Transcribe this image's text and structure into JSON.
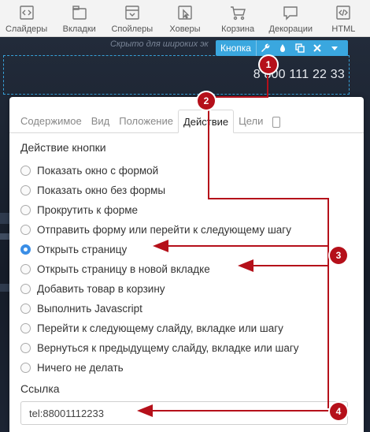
{
  "toolbar": {
    "items": [
      {
        "label": "Слайдеры",
        "icon": "sliders-icon"
      },
      {
        "label": "Вкладки",
        "icon": "tabs-icon"
      },
      {
        "label": "Спойлеры",
        "icon": "spoilers-icon"
      },
      {
        "label": "Ховеры",
        "icon": "hovers-icon"
      },
      {
        "label": "Корзина",
        "icon": "cart-icon"
      },
      {
        "label": "Декорации",
        "icon": "decorations-icon"
      },
      {
        "label": "HTML",
        "icon": "html-icon"
      }
    ]
  },
  "canvas": {
    "hidden_note": "Скрыто для широких эк",
    "phone": "8 800 111 22 33"
  },
  "element_toolbar": {
    "label": "Кнопка",
    "buttons": [
      "wrench-icon",
      "drop-icon",
      "copy-icon",
      "close-icon",
      "dropdown-icon"
    ]
  },
  "panel": {
    "tabs": [
      "Содержимое",
      "Вид",
      "Положение",
      "Действие",
      "Цели"
    ],
    "active_tab": "Действие",
    "action_title": "Действие кнопки",
    "options": [
      "Показать окно с формой",
      "Показать окно без формы",
      "Прокрутить к форме",
      "Отправить форму или перейти к следующему шагу",
      "Открыть страницу",
      "Открыть страницу в новой вкладке",
      "Добавить товар в корзину",
      "Выполнить Javascript",
      "Перейти к следующему слайду, вкладке или шагу",
      "Вернуться к предыдущему слайду, вкладке или шагу",
      "Ничего не делать"
    ],
    "selected_option": "Открыть страницу",
    "link_title": "Ссылка",
    "link_value": "tel:88001112233"
  },
  "annotations": {
    "markers": [
      "1",
      "2",
      "3",
      "4"
    ],
    "color": "#b5101a"
  }
}
